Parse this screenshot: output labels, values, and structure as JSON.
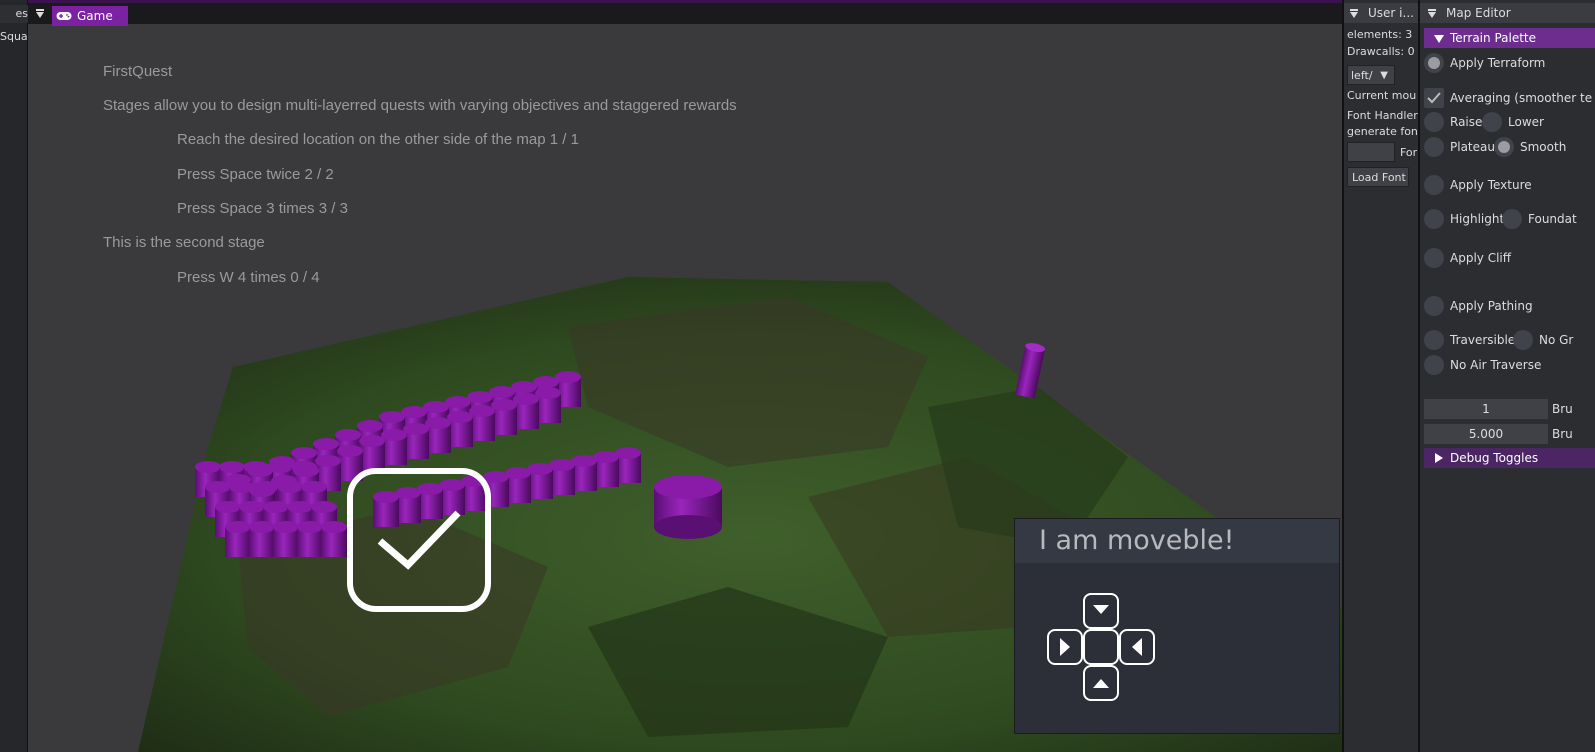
{
  "left_panel": {
    "tab_label": "es",
    "row_text": "Squa"
  },
  "game_window": {
    "tab_label": "Game",
    "tab_icon": "gamepad-icon",
    "close_icon": "close-icon"
  },
  "quest_log": {
    "title": "FirstQuest",
    "description": "Stages allow you to design multi-layerred quests with varying objectives and staggered rewards",
    "objectives_stage1": [
      "Reach the desired location on the other side of the map 1 / 1",
      "Press Space twice 2 / 2",
      "Press Space 3 times 3 / 3"
    ],
    "stage2_title": "This is the second stage",
    "objectives_stage2": [
      "Press W 4 times 0 / 4"
    ]
  },
  "overlay": {
    "checkbox_icon": "check-icon",
    "checked": true
  },
  "move_panel": {
    "title": "I am moveble!",
    "dpad": [
      "arrow-down-icon",
      "arrow-right-icon",
      "center",
      "arrow-left-icon",
      "arrow-up-icon"
    ]
  },
  "user_panel": {
    "title": "User i...",
    "elements": "elements: 3",
    "drawcalls": "Drawcalls: 0",
    "anchor_select": "left/",
    "current_mouse": "Current mou",
    "font_handler_1": "Font Handler",
    "font_handler_2": "generate fon",
    "font_label": "For",
    "load_font": "Load Font"
  },
  "map_editor": {
    "title": "Map Editor",
    "terrain_palette": "Terrain Palette",
    "apply_terraform": "Apply Terraform",
    "averaging": "Averaging (smoother te",
    "raise": "Raise",
    "lower": "Lower",
    "plateau": "Plateau",
    "smooth": "Smooth",
    "apply_texture": "Apply Texture",
    "highlight": "Highlight",
    "foundation": "Foundat",
    "apply_cliff": "Apply Cliff",
    "apply_pathing": "Apply Pathing",
    "traversible": "Traversible",
    "no_ground": "No Gr",
    "no_air": "No Air Traverse",
    "brush_size_value": "1",
    "brush_size_label": "Bru",
    "brush_strength_value": "5.000",
    "brush_strength_label": "Bru",
    "debug_toggles": "Debug Toggles"
  },
  "colors": {
    "accent": "#7b22a3",
    "section": "#6d2d8e",
    "pillar": "#8a1aa8",
    "grass": "#3a5a28"
  }
}
